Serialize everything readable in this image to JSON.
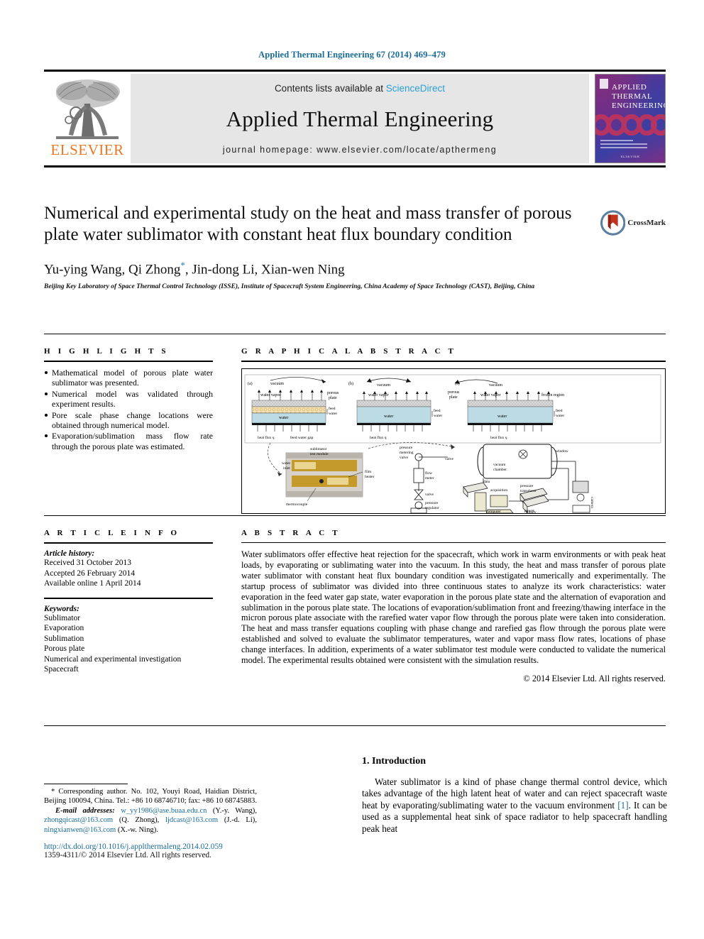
{
  "running_head": "Applied Thermal Engineering 67 (2014) 469–479",
  "masthead": {
    "contents_prefix": "Contents lists available at ",
    "sciencedirect": "ScienceDirect",
    "journal_title": "Applied Thermal Engineering",
    "homepage": "journal homepage: www.elsevier.com/locate/apthermeng",
    "publisher": "ELSEVIER",
    "cover_title_line1": "APPLIED",
    "cover_title_line2": "THERMAL",
    "cover_title_line3": "ENGINEERING",
    "cover_footer": "ELSEVIER"
  },
  "article": {
    "title": "Numerical and experimental study on the heat and mass transfer of porous plate water sublimator with constant heat flux boundary condition",
    "crossmark_label": "CrossMark",
    "authors": "Yu-ying Wang, Qi Zhong",
    "authors_star": "*",
    "authors_rest": ", Jin-dong Li, Xian-wen Ning",
    "affiliation": "Beijing Key Laboratory of Space Thermal Control Technology (ISSE), Institute of Spacecraft System Engineering, China Academy of Space Technology (CAST), Beijing, China"
  },
  "highlights": {
    "heading": "H I G H L I G H T S",
    "items": [
      "Mathematical model of porous plate water sublimator was presented.",
      "Numerical model was validated through experiment results.",
      "Pore scale phase change locations were obtained through numerical model.",
      "Evaporation/sublimation mass flow rate through the porous plate was estimated."
    ]
  },
  "graphical_abstract": {
    "heading": "G R A P H I C A L   A B S T R A C T",
    "figure_labels": {
      "panel_a": "(a)",
      "panel_b": "(b)",
      "panel_c": "(c)",
      "vacuum": "vacuum",
      "water_vapor": "water vapor",
      "porous_plate": "porous plate",
      "feed_water": "feed water",
      "water": "water",
      "heat_flux": "heat flux q",
      "feed_water_gap": "feed water gap",
      "frozen_region": "frozen region",
      "sublimator_test_module": "sublimator test module",
      "water_inlet": "water inlet",
      "film_heater": "film heater",
      "thermocouple": "thermocouple",
      "pressure_metering_valve": "pressure metering valve",
      "flow_meter": "flow meter",
      "valve": "valve",
      "pressure_regulator": "pressure regulator",
      "water_tank": "water tank",
      "vacuum_chamber": "vacuum chamber",
      "window": "window",
      "data_acquisition": "data acquisition",
      "pressure_transducer": "pressure transducer",
      "computer": "computer",
      "power_supply": "power supply",
      "camera": "camera"
    }
  },
  "article_info": {
    "heading": "A R T I C L E   I N F O",
    "history_label": "Article history:",
    "history": [
      "Received 31 October 2013",
      "Accepted 26 February 2014",
      "Available online 1 April 2014"
    ],
    "keywords_label": "Keywords:",
    "keywords": [
      "Sublimator",
      "Evaporation",
      "Sublimation",
      "Porous plate",
      "Numerical and experimental investigation",
      "Spacecraft"
    ]
  },
  "abstract": {
    "heading": "A B S T R A C T",
    "text": "Water sublimators offer effective heat rejection for the spacecraft, which work in warm environments or with peak heat loads, by evaporating or sublimating water into the vacuum. In this study, the heat and mass transfer of porous plate water sublimator with constant heat flux boundary condition was investigated numerically and experimentally. The startup process of sublimator was divided into three continuous states to analyze its work characteristics: water evaporation in the feed water gap state, water evaporation in the porous plate state and the alternation of evaporation and sublimation in the porous plate state. The locations of evaporation/sublimation front and freezing/thawing interface in the micron porous plate associate with the rarefied water vapor flow through the porous plate were taken into consideration. The heat and mass transfer equations coupling with phase change and rarefied gas flow through the porous plate were established and solved to evaluate the sublimator temperatures, water and vapor mass flow rates, locations of phase change interfaces. In addition, experiments of a water sublimator test module were conducted to validate the numerical model. The experimental results obtained were consistent with the simulation results.",
    "copyright": "© 2014 Elsevier Ltd. All rights reserved."
  },
  "introduction": {
    "heading": "1. Introduction",
    "paragraph_part1": "Water sublimator is a kind of phase change thermal control device, which takes advantage of the high latent heat of water and can reject spacecraft waste heat by evaporating/sublimating water to the vacuum environment ",
    "reference": "[1]",
    "paragraph_part2": ". It can be used as a supplemental heat sink of space radiator to help spacecraft handling peak heat"
  },
  "footer": {
    "corresponding_marker": "*",
    "corresponding_text": " Corresponding author. No. 102, Youyi Road, Haidian District, Beijing 100094, China. Tel.: +86 10 68746710; fax: +86 10 68745883.",
    "email_label": "E-mail addresses:",
    "emails": [
      {
        "address": "w_yy1986@ase.buaa.edu.cn",
        "name": " (Y.-y. Wang), "
      },
      {
        "address": "zhongqicast@163.com",
        "name": " (Q. Zhong), "
      },
      {
        "address": "ljdcast@163.com",
        "name": " (J.-d. Li), "
      },
      {
        "address": "ningxianwen@163.com",
        "name": " (X.-w. Ning)."
      }
    ],
    "doi": "http://dx.doi.org/10.1016/j.applthermaleng.2014.02.059",
    "issn": "1359-4311/© 2014 Elsevier Ltd. All rights reserved."
  }
}
